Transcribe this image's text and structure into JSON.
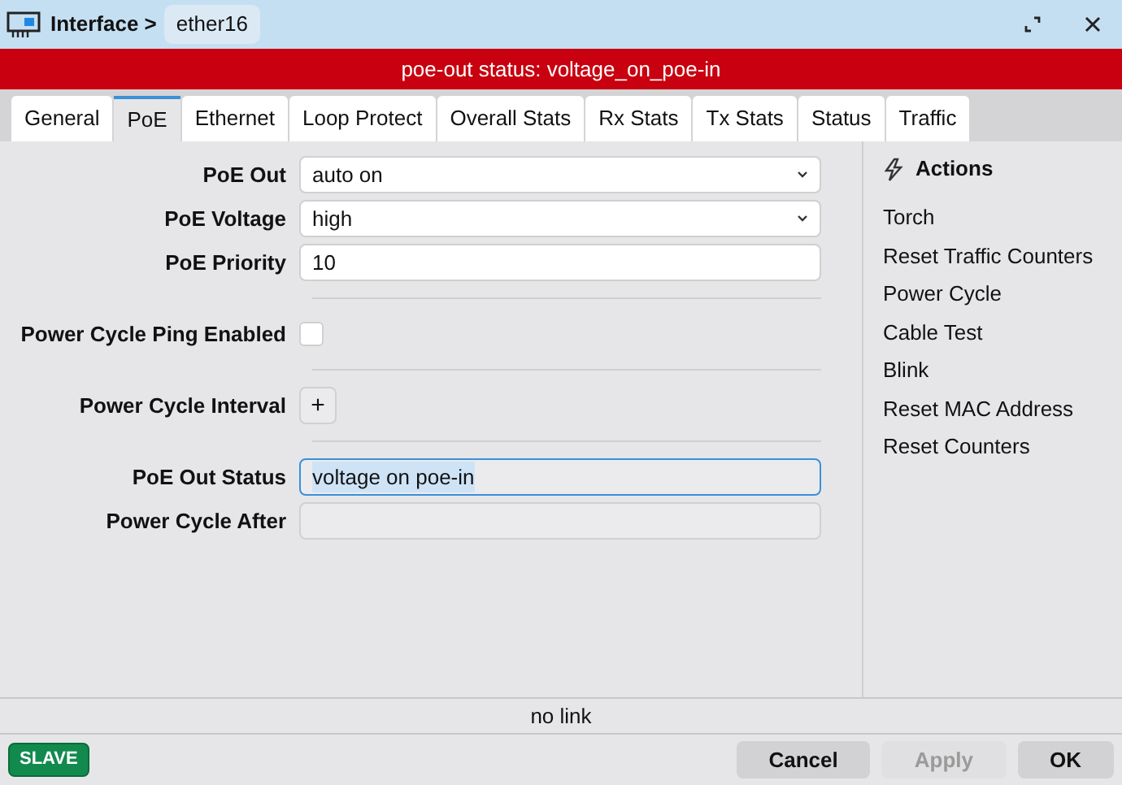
{
  "window": {
    "title": "Interface >",
    "name": "ether16"
  },
  "banner": "poe-out status: voltage_on_poe-in",
  "tabs": [
    {
      "label": "General",
      "selected": false
    },
    {
      "label": "PoE",
      "selected": true
    },
    {
      "label": "Ethernet",
      "selected": false
    },
    {
      "label": "Loop Protect",
      "selected": false
    },
    {
      "label": "Overall Stats",
      "selected": false
    },
    {
      "label": "Rx Stats",
      "selected": false
    },
    {
      "label": "Tx Stats",
      "selected": false
    },
    {
      "label": "Status",
      "selected": false
    },
    {
      "label": "Traffic",
      "selected": false
    }
  ],
  "form_groups": [
    [
      {
        "kind": "select",
        "label": "PoE Out",
        "value": "auto on"
      },
      {
        "kind": "select",
        "label": "PoE Voltage",
        "value": "high"
      },
      {
        "kind": "text",
        "label": "PoE Priority",
        "value": "10"
      }
    ],
    [
      {
        "kind": "checkbox",
        "label": "Power Cycle Ping Enabled",
        "checked": false
      }
    ],
    [
      {
        "kind": "add",
        "label": "Power Cycle Interval",
        "button": "+"
      }
    ],
    [
      {
        "kind": "status",
        "label": "PoE Out Status",
        "value": "voltage on poe-in",
        "focused": true
      },
      {
        "kind": "readonly",
        "label": "Power Cycle After"
      }
    ]
  ],
  "actions": {
    "title": "Actions",
    "items": [
      "Torch",
      "Reset Traffic Counters",
      "Power Cycle",
      "Cable Test",
      "Blink",
      "Reset MAC Address",
      "Reset Counters"
    ]
  },
  "status_bar": "no link",
  "badge": "SLAVE",
  "buttons": [
    {
      "label": "Cancel",
      "disabled": false
    },
    {
      "label": "Apply",
      "disabled": true
    },
    {
      "label": "OK",
      "disabled": false
    }
  ]
}
